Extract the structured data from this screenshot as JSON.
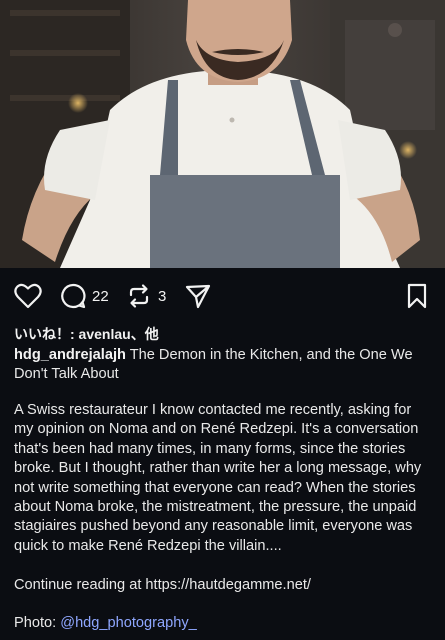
{
  "post": {
    "image_subject": "chef-in-apron-photo",
    "comment_count": "22",
    "repost_count": "3",
    "likes_text": "いいね！: avenlau、他",
    "author": "hdg_andrejalajh",
    "title": "The Demon in the Kitchen, and the One We Don't Talk About",
    "body": "A Swiss restaurateur I know contacted me recently, asking for my opinion on Noma and on René Redzepi. It's a conversation that's been had many times, in many forms, since the stories broke. But I thought, rather than write her a long message, why not write something that everyone can read? When the stories about Noma broke, the mistreatment, the pressure, the unpaid stagiaires pushed beyond any reasonable limit, everyone was quick to make René Redzepi the villain....",
    "continue": "Continue reading at https://hautdegamme.net/",
    "photo_label": "Photo: ",
    "photo_handle": "@hdg_photography_"
  },
  "icons": {
    "like": "heart-icon",
    "comment": "comment-bubble-icon",
    "repost": "repost-icon",
    "share": "send-icon",
    "save": "bookmark-icon"
  },
  "colors": {
    "background": "#0b0d12",
    "text": "#e9e9e9",
    "mention": "#8fa7ff"
  }
}
